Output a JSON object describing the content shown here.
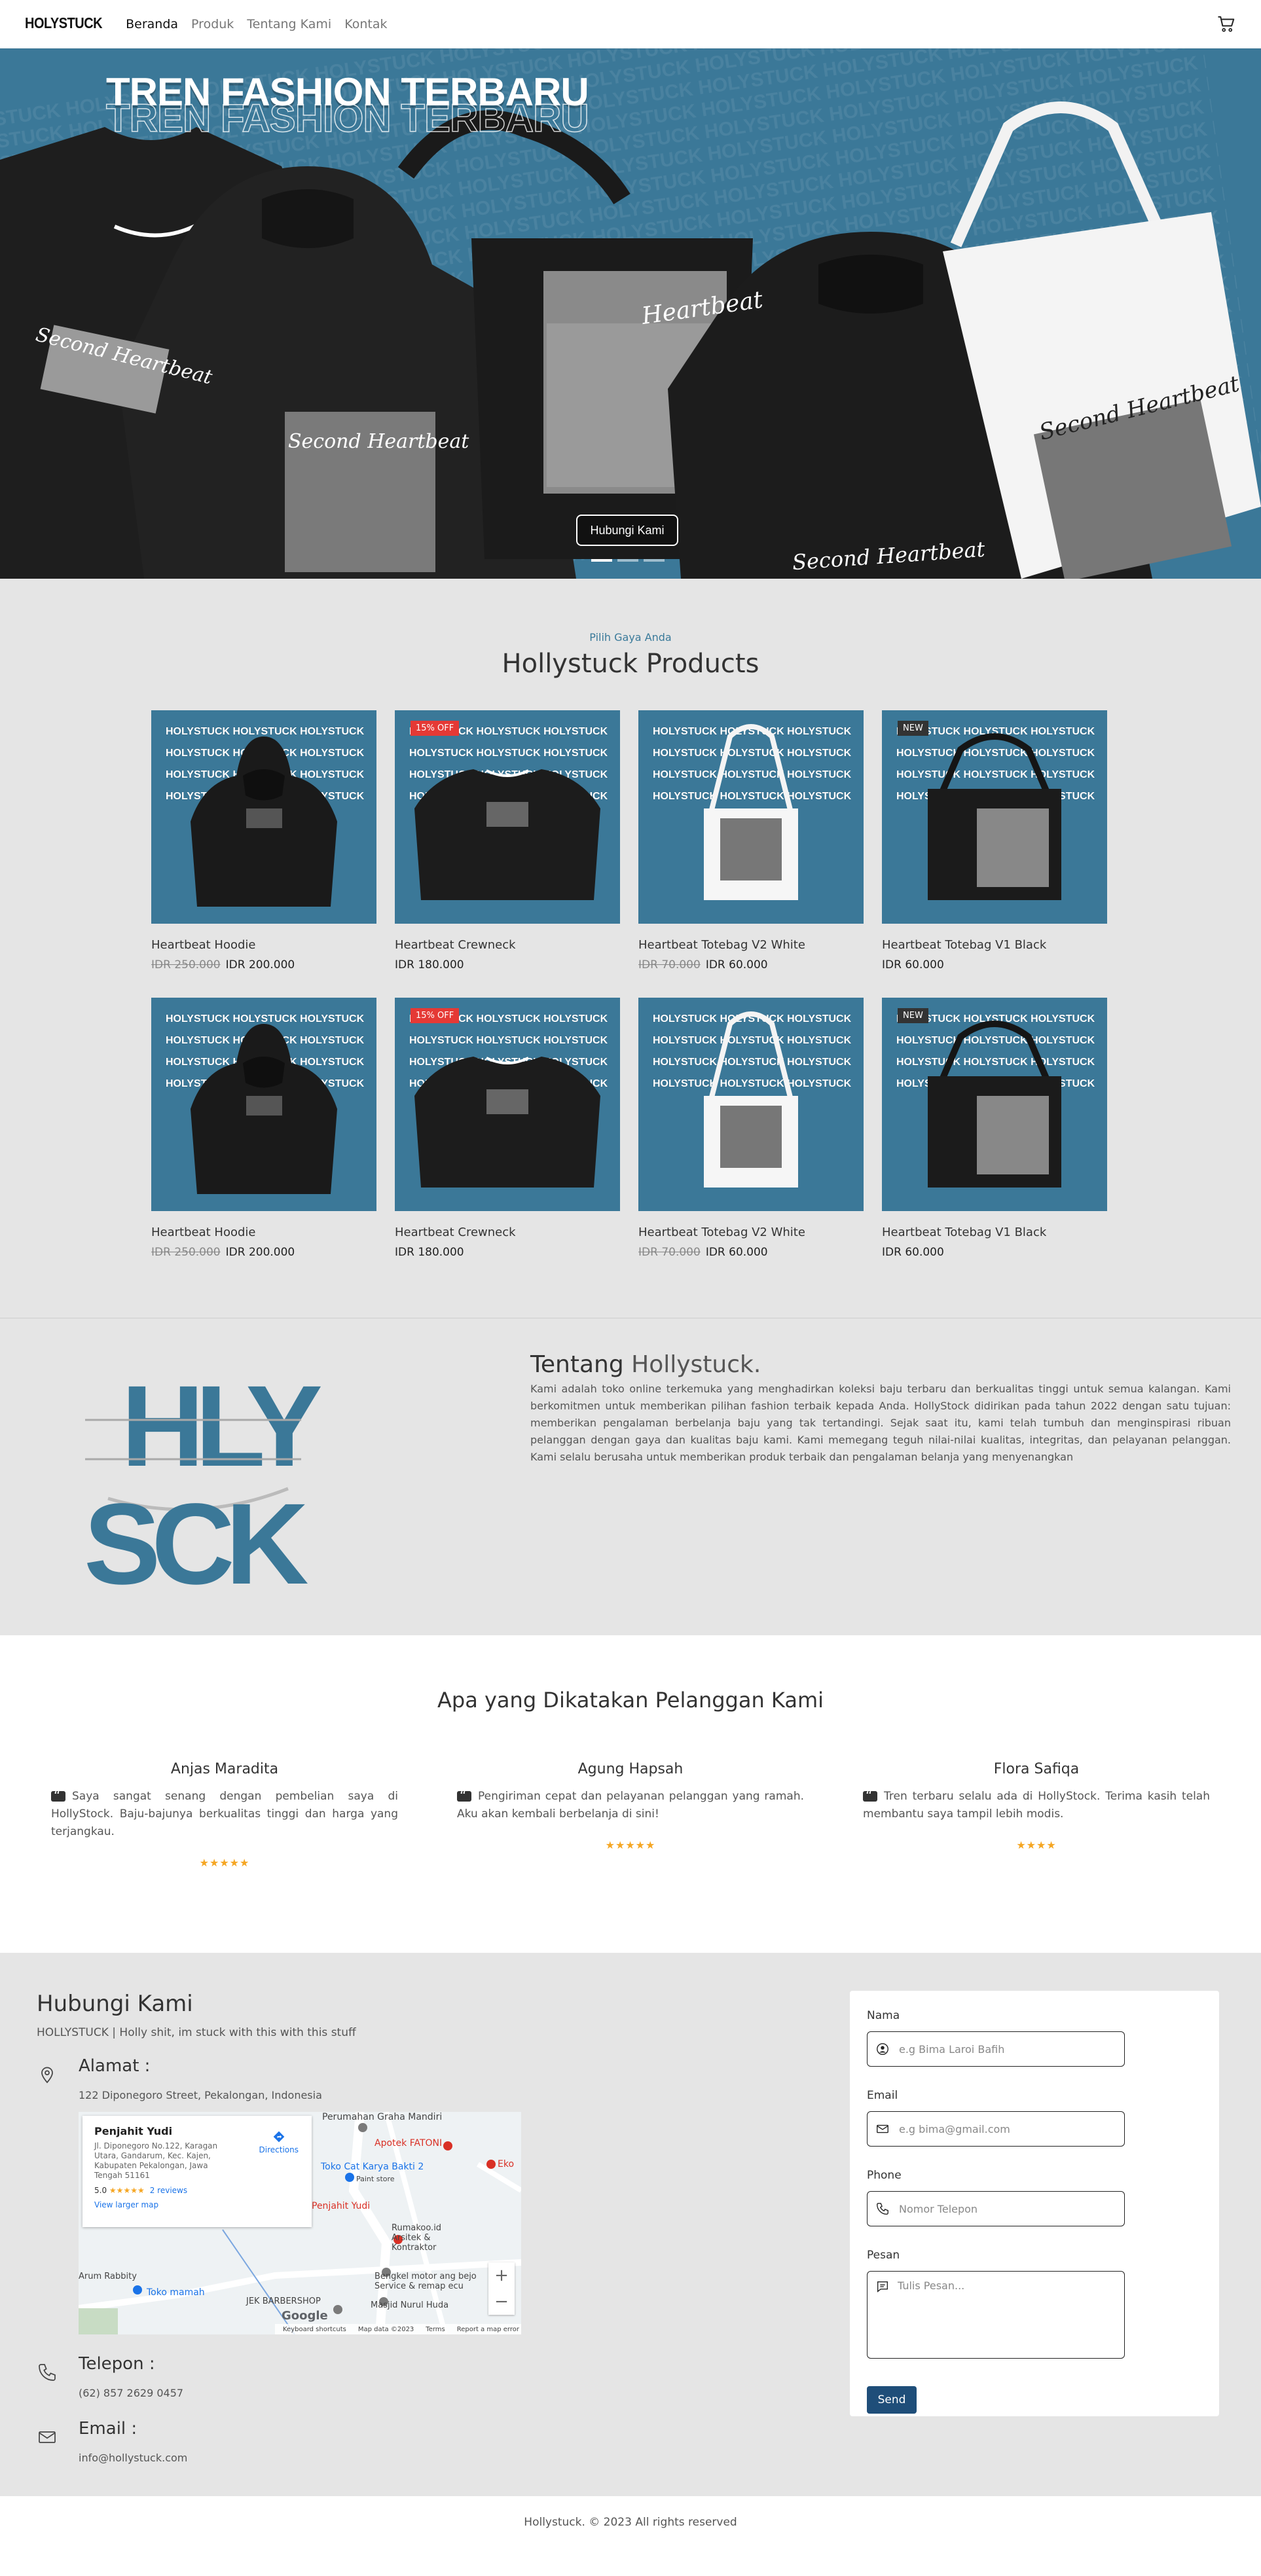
{
  "nav": {
    "brand": "HOLYSTUCK",
    "links": [
      "Beranda",
      "Produk",
      "Tentang Kami",
      "Kontak"
    ],
    "cart_icon": "cart-icon"
  },
  "hero": {
    "title": "TREN FASHION TERBARU",
    "pattern_text": "HOLYSTUCK HOLYSTUCK HOLYSTUCK HOLYSTUCK HOLYSTUCK HOLYSTUCK HOLYSTUCK HOLYSTUCK",
    "script_text": "Second Heartbeat",
    "script_text_2": "Heartbeat",
    "cta_label": "Hubungi Kami",
    "slides_count": 3,
    "active_slide": 1,
    "bg_color": "#3b7898"
  },
  "products": {
    "kicker": "Pilih Gaya Anda",
    "title": "Hollystuck Products",
    "pattern_text": "HOLYSTUCK HOLYSTUCK HOLYSTUCK",
    "items": [
      {
        "name": "Heartbeat Hoodie",
        "old_price": "IDR 250.000",
        "price": "IDR 200.000",
        "badge": "",
        "kind": "hoodie"
      },
      {
        "name": "Heartbeat Crewneck",
        "old_price": "",
        "price": "IDR 180.000",
        "badge": "15% OFF",
        "kind": "crewneck"
      },
      {
        "name": "Heartbeat Totebag V2 White",
        "old_price": "IDR 70.000",
        "price": "IDR 60.000",
        "badge": "",
        "kind": "tote-white"
      },
      {
        "name": "Heartbeat Totebag V1 Black",
        "old_price": "",
        "price": "IDR 60.000",
        "badge": "NEW",
        "kind": "tote-black"
      },
      {
        "name": "Heartbeat Hoodie",
        "old_price": "IDR 250.000",
        "price": "IDR 200.000",
        "badge": "",
        "kind": "hoodie"
      },
      {
        "name": "Heartbeat Crewneck",
        "old_price": "",
        "price": "IDR 180.000",
        "badge": "15% OFF",
        "kind": "crewneck"
      },
      {
        "name": "Heartbeat Totebag V2 White",
        "old_price": "IDR 70.000",
        "price": "IDR 60.000",
        "badge": "",
        "kind": "tote-white"
      },
      {
        "name": "Heartbeat Totebag V1 Black",
        "old_price": "",
        "price": "IDR 60.000",
        "badge": "NEW",
        "kind": "tote-black"
      }
    ]
  },
  "about": {
    "logo_top": "HLY",
    "logo_bottom": "SCK",
    "title_prefix": "Tentang ",
    "title_brand": "Hollystuck.",
    "body": "Kami adalah toko online terkemuka yang menghadirkan koleksi baju terbaru dan berkualitas tinggi untuk semua kalangan. Kami berkomitmen untuk memberikan pilihan fashion terbaik kepada Anda. HollyStock didirikan pada tahun 2022 dengan satu tujuan: memberikan pengalaman berbelanja baju yang tak tertandingi. Sejak saat itu, kami telah tumbuh dan menginspirasi ribuan pelanggan dengan gaya dan kualitas baju kami. Kami memegang teguh nilai-nilai kualitas, integritas, dan pelayanan pelanggan. Kami selalu berusaha untuk memberikan produk terbaik dan pengalaman belanja yang menyenangkan",
    "accent": "#3b7898"
  },
  "testimonials": {
    "title": "Apa yang Dikatakan Pelanggan Kami",
    "items": [
      {
        "name": "Anjas Maradita",
        "text": "Saya sangat senang dengan pembelian saya di HollyStock. Baju-bajunya berkualitas tinggi dan harga yang terjangkau.",
        "stars": "★★★★★"
      },
      {
        "name": "Agung Hapsah",
        "text": "Pengiriman cepat dan pelayanan pelanggan yang ramah. Aku akan kembali berbelanja di sini!",
        "stars": "★★★★★"
      },
      {
        "name": "Flora Safiqa",
        "text": "Tren terbaru selalu ada di HollyStock. Terima kasih telah membantu saya tampil lebih modis.",
        "stars": "★★★★"
      }
    ]
  },
  "contact": {
    "title": "Hubungi Kami",
    "tagline": "HOLLYSTUCK | Holly shit, im stuck with this with this stuff",
    "address_label": "Alamat :",
    "address": "122 Diponegoro Street, Pekalongan, Indonesia",
    "phone_label": "Telepon :",
    "phone": "(62) 857 2629 0457",
    "email_label": "Email :",
    "email": "info@hollystuck.com",
    "map": {
      "place_name": "Penjahit Yudi",
      "place_address": "Jl. Diponegoro No.122, Karagan Utara, Gandarum, Kec. Kajen, Kabupaten Pekalongan, Jawa Tengah 51161",
      "rating": "5.0",
      "stars": "★★★★★",
      "reviews": "2 reviews",
      "larger_map": "View larger map",
      "directions": "Directions",
      "labels": {
        "perumahan": "Perumahan Graha Mandiri",
        "apotek": "Apotek FATONI",
        "eko": "Eko",
        "tokocat": "Toko Cat Karya Bakti 2",
        "paintstore": "Paint store",
        "penjahit": "Penjahit Yudi",
        "rumakoo": "Rumakoo.id Arsitek & Kontraktor",
        "bengkel": "Bengkel motor ang bejo Service & remap ecu",
        "rabbity": "Arum Rabbity",
        "tokomamah": "Toko mamah",
        "jek": "JEK BARBERSHOP",
        "masjid": "Masjid Nurul Huda"
      },
      "google": "Google",
      "footer": [
        "Keyboard shortcuts",
        "Map data ©2023",
        "Terms",
        "Report a map error"
      ]
    },
    "form": {
      "name_label": "Nama",
      "name_placeholder": "e.g Bima Laroi Bafih",
      "email_label": "Email",
      "email_placeholder": "e.g bima@gmail.com",
      "phone_label": "Phone",
      "phone_placeholder": "Nomor Telepon",
      "message_label": "Pesan",
      "message_placeholder": "Tulis Pesan...",
      "send_label": "Send"
    }
  },
  "footer": {
    "text": "Hollystuck. © 2023 All rights reserved"
  }
}
